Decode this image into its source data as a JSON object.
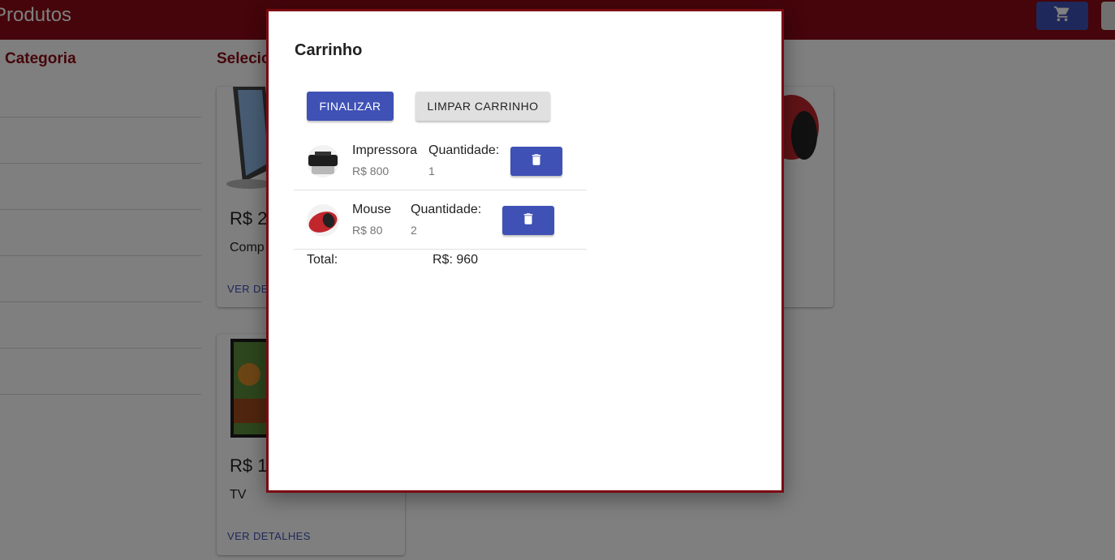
{
  "appbar": {
    "title": "Produtos",
    "cart_icon": "shopping-cart-icon"
  },
  "sidebar": {
    "title": "Categoria",
    "items": [
      {
        "label": ""
      },
      {
        "label": ""
      },
      {
        "label": ""
      },
      {
        "label": ""
      },
      {
        "label": ""
      },
      {
        "label": ""
      },
      {
        "label": ""
      }
    ]
  },
  "products": {
    "title": "Selecione",
    "cards": [
      {
        "price": "R$ 2",
        "name": "Comp",
        "link": "VER DETALHES"
      },
      {
        "price": "R$ 1",
        "name": "TV",
        "link": "VER DETALHES"
      }
    ]
  },
  "modal": {
    "title": "Carrinho",
    "finalize_label": "FINALIZAR",
    "clear_label": "LIMPAR CARRINHO",
    "items": [
      {
        "name": "Impressora",
        "price": "R$ 800",
        "qty_label": "Quantidade:",
        "qty": "1",
        "delete_icon": "trash-icon"
      },
      {
        "name": "Mouse",
        "price": "R$ 80",
        "qty_label": "Quantidade:",
        "qty": "2",
        "delete_icon": "trash-icon"
      }
    ],
    "total_label": "Total:",
    "total_value": "R$: 960"
  },
  "colors": {
    "primary": "#3f51b5",
    "brand": "#8b0a14",
    "modal_border": "#7a0a12"
  }
}
